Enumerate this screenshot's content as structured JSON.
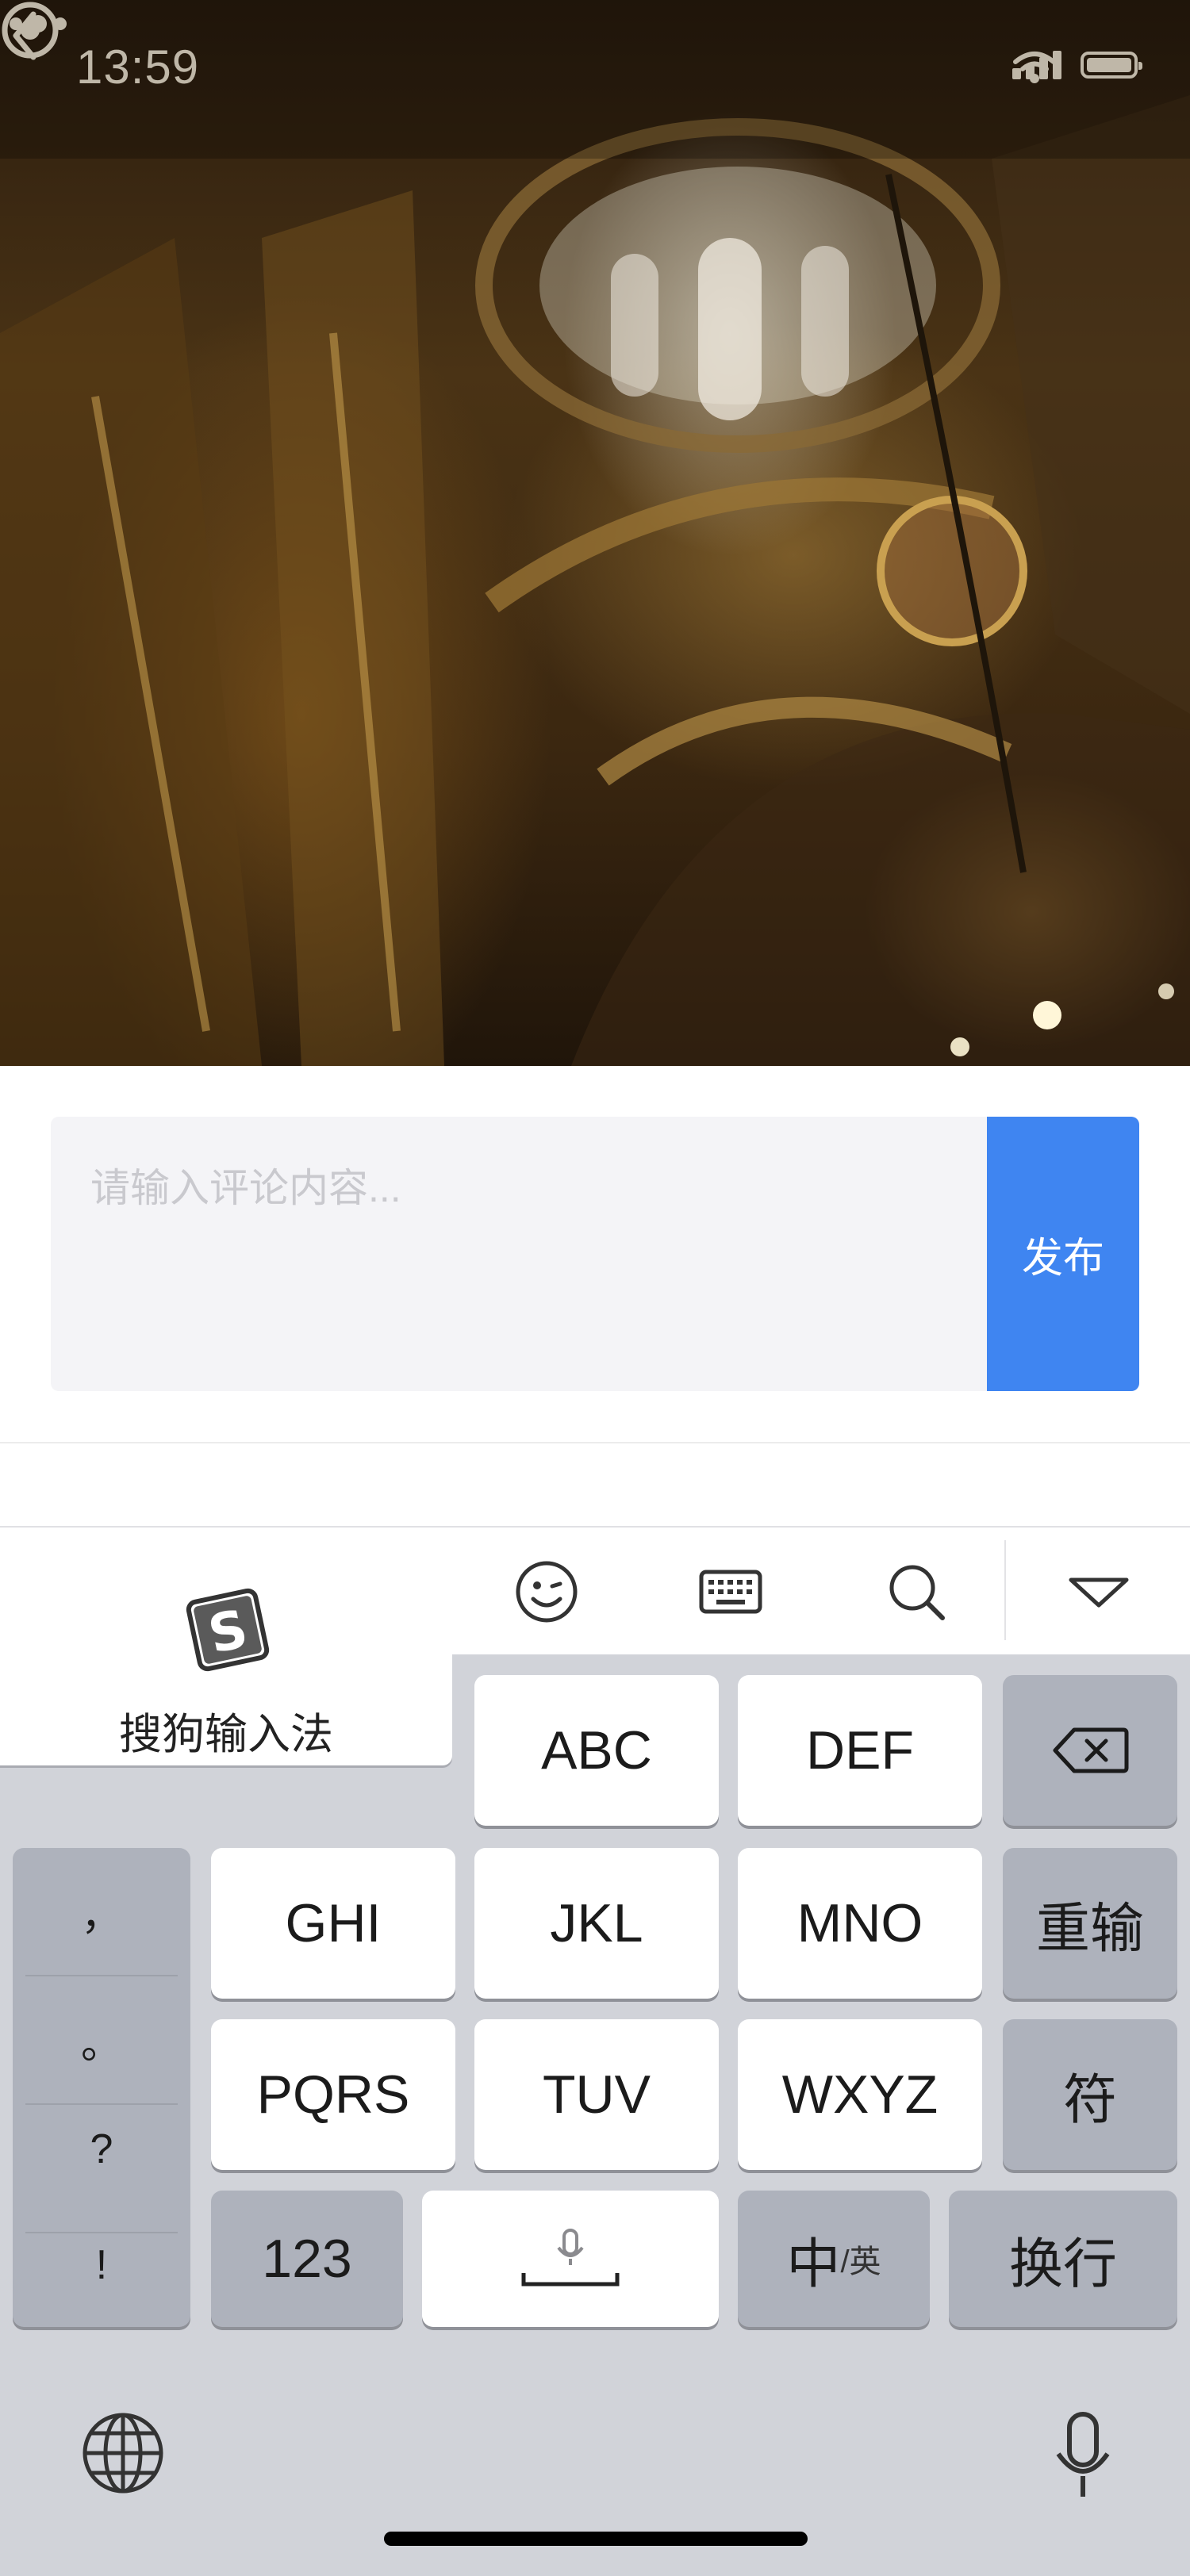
{
  "status_bar": {
    "time": "13:59"
  },
  "comment": {
    "placeholder": "请输入评论内容...",
    "publish_label": "发布"
  },
  "keyboard": {
    "brand_name": "搜狗输入法",
    "toolbar": [
      "emoji-icon",
      "keyboard-icon",
      "search-icon",
      "collapse-icon"
    ],
    "keys": {
      "abc": "ABC",
      "def": "DEF",
      "ghi": "GHI",
      "jkl": "JKL",
      "mno": "MNO",
      "pqrs": "PQRS",
      "tuv": "TUV",
      "wxyz": "WXYZ",
      "num": "123",
      "reinput": "重输",
      "symbol": "符",
      "chinese": "中",
      "english_sub": "/英",
      "newline": "换行"
    },
    "punctuation": [
      "，",
      "。",
      "?",
      "!"
    ]
  },
  "colors": {
    "accent": "#3f85f1",
    "keyboard_bg": "#d1d3d9",
    "key_gray": "#aeb2bc"
  }
}
